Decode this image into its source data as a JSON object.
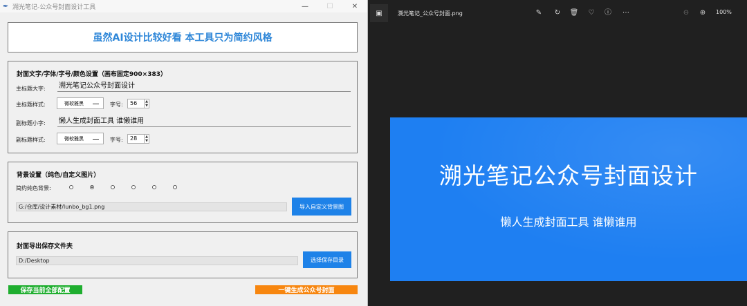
{
  "app": {
    "window_title": "溯光笔记-公众号封面设计工具",
    "window_controls": {
      "minimize": "—",
      "maximize": "☐",
      "close": "✕"
    },
    "header": "虽然AI设计比较好看 本工具只为简约风格",
    "text_group": {
      "title": "封面文字/字体/字号/颜色设置（画布固定900×383）",
      "main_title_label": "主标题大字:",
      "main_title_value": "溯光笔记公众号封面设计",
      "main_style_label": "主标题样式:",
      "main_font": "微软雅黑",
      "size_label": "字号:",
      "main_size": "56",
      "subtitle_label": "副标题小字:",
      "subtitle_value": "懒人生成封面工具 谁懒谁用",
      "sub_style_label": "副标题样式:",
      "sub_font": "微软雅黑",
      "sub_size": "28"
    },
    "bg_group": {
      "title": "背景设置（纯色/自定义图片）",
      "solid_label": "简约纯色背景:",
      "radios": [
        false,
        true,
        false,
        false,
        false,
        false
      ],
      "image_path": "G:/仓库/设计素材/lunbo_bg1.png",
      "import_button": "导入自定义背景图"
    },
    "export_group": {
      "title": "封面导出保存文件夹",
      "folder_path": "D:/Desktop",
      "choose_button": "选择保存目录"
    },
    "save_all_button": "保存当前全部配置",
    "generate_button": "一键生成公众号封面",
    "colors": {
      "accent_blue": "#1e82e8",
      "header_text": "#2d86d8",
      "save_green": "#1fae2f",
      "generate_orange": "#f7860f"
    }
  },
  "viewer": {
    "file_name": "溯光笔记_公众号封面.png",
    "zoom_level": "100%",
    "icons": [
      "edit-icon",
      "rotate-icon",
      "delete-icon",
      "favorite-icon",
      "info-icon",
      "more-icon",
      "zoom-out-icon",
      "zoom-in-icon"
    ],
    "cover": {
      "title": "溯光笔记公众号封面设计",
      "subtitle": "懒人生成封面工具 谁懒谁用",
      "background": "#1e7ff2"
    }
  }
}
